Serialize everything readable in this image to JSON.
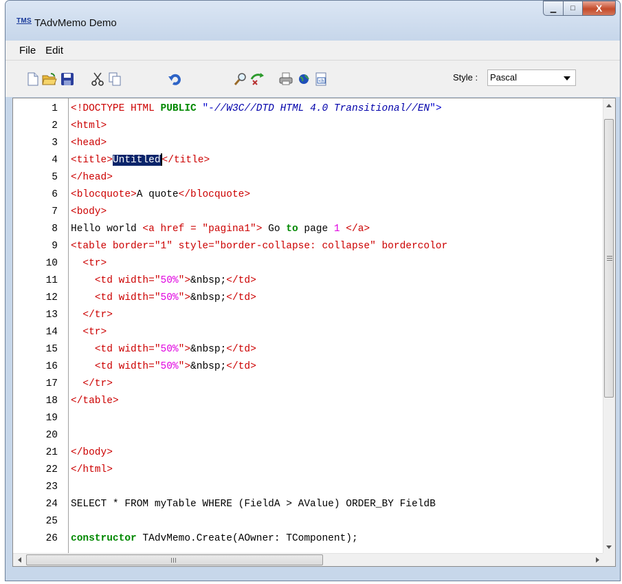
{
  "window": {
    "title": "TAdvMemo Demo",
    "app_icon_text": "TMS"
  },
  "title_controls": {
    "minimize_glyph": "▁",
    "maximize_glyph": "□",
    "close_glyph": "X"
  },
  "menu": {
    "items": [
      "File",
      "Edit"
    ]
  },
  "toolbar": {
    "buttons": [
      "new-file-icon",
      "open-folder-icon",
      "save-icon",
      "cut-icon",
      "copy-icon",
      "undo-icon",
      "find-icon",
      "replace-icon",
      "print-icon",
      "web-icon",
      "highlight-icon"
    ],
    "style_label": "Style :",
    "style_value": "Pascal"
  },
  "editor": {
    "line_numbers": [
      "1",
      "2",
      "3",
      "4",
      "5",
      "6",
      "7",
      "8",
      "9",
      "10",
      "11",
      "12",
      "13",
      "14",
      "15",
      "16",
      "17",
      "18",
      "19",
      "20",
      "21",
      "22",
      "23",
      "24",
      "25",
      "26"
    ],
    "lines": [
      [
        {
          "t": "tag",
          "v": "<!DOCTYPE HTML "
        },
        {
          "t": "kw",
          "v": "PUBLIC"
        },
        {
          "t": "str",
          "v": " \"-"
        },
        {
          "t": "comment",
          "v": "//W3C//DTD HTML 4.0 Transitional//EN"
        },
        {
          "t": "str",
          "v": "\">"
        }
      ],
      [
        {
          "t": "tag",
          "v": "<html>"
        }
      ],
      [
        {
          "t": "tag",
          "v": "<head>"
        }
      ],
      [
        {
          "t": "tag",
          "v": "<title>"
        },
        {
          "t": "sel",
          "v": "Untitled"
        },
        {
          "t": "tag",
          "v": "</title>"
        }
      ],
      [
        {
          "t": "tag",
          "v": "</head>"
        }
      ],
      [
        {
          "t": "tag",
          "v": "<blocquote>"
        },
        {
          "t": "plain",
          "v": "A quote"
        },
        {
          "t": "tag",
          "v": "</blocquote>"
        }
      ],
      [
        {
          "t": "tag",
          "v": "<body>"
        }
      ],
      [
        {
          "t": "plain",
          "v": "Hello world "
        },
        {
          "t": "tag",
          "v": "<a href = \"pagina1\">"
        },
        {
          "t": "plain",
          "v": " Go "
        },
        {
          "t": "kw",
          "v": "to"
        },
        {
          "t": "plain",
          "v": " page "
        },
        {
          "t": "num",
          "v": "1"
        },
        {
          "t": "plain",
          "v": " "
        },
        {
          "t": "tag",
          "v": "</a>"
        }
      ],
      [
        {
          "t": "tag",
          "v": "<table border=\"1\" style=\"border-collapse: collapse\" bordercolor"
        }
      ],
      [
        {
          "t": "plain",
          "v": "  "
        },
        {
          "t": "tag",
          "v": "<tr>"
        }
      ],
      [
        {
          "t": "plain",
          "v": "    "
        },
        {
          "t": "tag",
          "v": "<td width=\""
        },
        {
          "t": "num",
          "v": "50%"
        },
        {
          "t": "tag",
          "v": "\">"
        },
        {
          "t": "plain",
          "v": "&nbsp;"
        },
        {
          "t": "tag",
          "v": "</td>"
        }
      ],
      [
        {
          "t": "plain",
          "v": "    "
        },
        {
          "t": "tag",
          "v": "<td width=\""
        },
        {
          "t": "num",
          "v": "50%"
        },
        {
          "t": "tag",
          "v": "\">"
        },
        {
          "t": "plain",
          "v": "&nbsp;"
        },
        {
          "t": "tag",
          "v": "</td>"
        }
      ],
      [
        {
          "t": "plain",
          "v": "  "
        },
        {
          "t": "tag",
          "v": "</tr>"
        }
      ],
      [
        {
          "t": "plain",
          "v": "  "
        },
        {
          "t": "tag",
          "v": "<tr>"
        }
      ],
      [
        {
          "t": "plain",
          "v": "    "
        },
        {
          "t": "tag",
          "v": "<td width=\""
        },
        {
          "t": "num",
          "v": "50%"
        },
        {
          "t": "tag",
          "v": "\">"
        },
        {
          "t": "plain",
          "v": "&nbsp;"
        },
        {
          "t": "tag",
          "v": "</td>"
        }
      ],
      [
        {
          "t": "plain",
          "v": "    "
        },
        {
          "t": "tag",
          "v": "<td width=\""
        },
        {
          "t": "num",
          "v": "50%"
        },
        {
          "t": "tag",
          "v": "\">"
        },
        {
          "t": "plain",
          "v": "&nbsp;"
        },
        {
          "t": "tag",
          "v": "</td>"
        }
      ],
      [
        {
          "t": "plain",
          "v": "  "
        },
        {
          "t": "tag",
          "v": "</tr>"
        }
      ],
      [
        {
          "t": "tag",
          "v": "</table>"
        }
      ],
      [],
      [],
      [
        {
          "t": "tag",
          "v": "</body>"
        }
      ],
      [
        {
          "t": "tag",
          "v": "</html>"
        }
      ],
      [],
      [
        {
          "t": "plain",
          "v": "SELECT * FROM myTable WHERE (FieldA > AValue) ORDER_BY FieldB"
        }
      ],
      [],
      [
        {
          "t": "kw",
          "v": "constructor"
        },
        {
          "t": "plain",
          "v": " TAdvMemo.Create(AOwner: TComponent);"
        }
      ]
    ]
  },
  "colors": {
    "tag": "#cc0000",
    "keyword": "#008800",
    "string": "#0000cc",
    "comment": "#0000aa",
    "number": "#e000e0",
    "selection": "#0a246a"
  }
}
